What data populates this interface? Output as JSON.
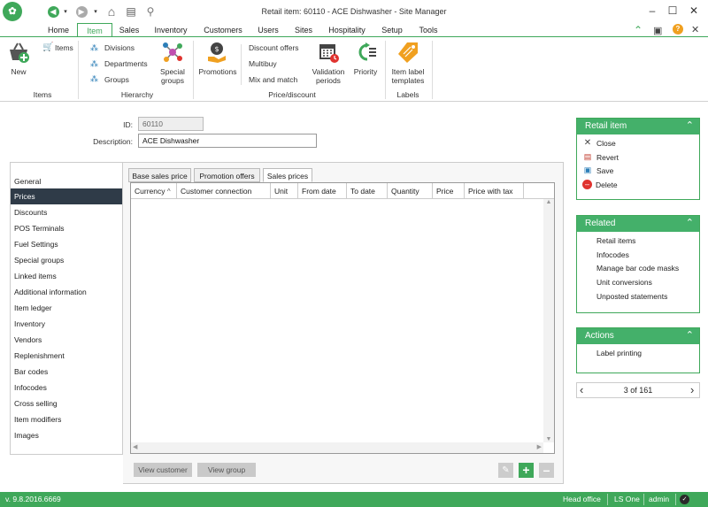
{
  "window": {
    "title": "Retail item: 60110 - ACE Dishwasher - Site Manager"
  },
  "menu_tabs": [
    "Home",
    "Item",
    "Sales",
    "Inventory",
    "Customers",
    "Users",
    "Sites",
    "Hospitality",
    "Setup",
    "Tools"
  ],
  "ribbon": {
    "new_label": "New",
    "items_label": "Items",
    "items_group": "Items",
    "divisions": "Divisions",
    "departments": "Departments",
    "groups": "Groups",
    "special_groups_l1": "Special",
    "special_groups_l2": "groups",
    "hierarchy_group": "Hierarchy",
    "promotions": "Promotions",
    "discount_offers": "Discount offers",
    "multibuy": "Multibuy",
    "mix_and_match": "Mix and match",
    "validation_l1": "Validation",
    "validation_l2": "periods",
    "priority": "Priority",
    "price_group": "Price/discount",
    "label_tpl_l1": "Item label",
    "label_tpl_l2": "templates",
    "labels_group": "Labels"
  },
  "form": {
    "id_label": "ID:",
    "id_value": "60110",
    "desc_label": "Description:",
    "desc_value": "ACE Dishwasher"
  },
  "nav_items": [
    "General",
    "Prices",
    "Discounts",
    "POS Terminals",
    "Fuel Settings",
    "Special groups",
    "Linked items",
    "Additional information",
    "Item ledger",
    "Inventory",
    "Vendors",
    "Replenishment",
    "Bar codes",
    "Infocodes",
    "Cross selling",
    "Item modifiers",
    "Images"
  ],
  "sub_tabs": [
    "Base sales price",
    "Promotion offers",
    "Sales prices"
  ],
  "grid_columns": [
    "Currency",
    "Customer connection",
    "Unit",
    "From date",
    "To date",
    "Quantity",
    "Price",
    "Price with tax"
  ],
  "buttons": {
    "view_customer": "View customer",
    "view_group": "View group"
  },
  "retail_card": {
    "title": "Retail item",
    "actions": [
      "Close",
      "Revert",
      "Save",
      "Delete"
    ]
  },
  "related_card": {
    "title": "Related",
    "links": [
      "Retail items",
      "Infocodes",
      "Manage bar code masks",
      "Unit conversions",
      "Unposted statements"
    ]
  },
  "actions_card": {
    "title": "Actions",
    "links": [
      "Label printing"
    ]
  },
  "pager": {
    "text": "3 of 161"
  },
  "status": {
    "version": "v. 9.8.2016.6669",
    "site": "Head office",
    "product": "LS One",
    "user": "admin"
  },
  "colors": {
    "accent": "#3fa85a",
    "nav_selected": "#2f3b48",
    "delete": "#e0332f"
  }
}
